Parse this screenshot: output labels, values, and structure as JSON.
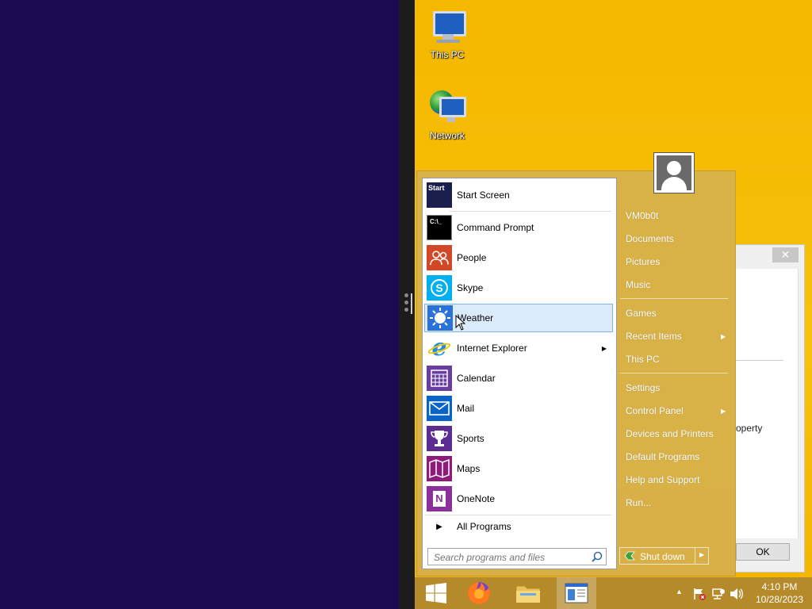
{
  "desktop": {
    "icons": [
      {
        "label": "This PC",
        "icon": "this-pc-icon"
      },
      {
        "label": "Network",
        "icon": "network-icon"
      }
    ]
  },
  "background_dialog": {
    "close_glyph": "✕",
    "fragment_text": "operty",
    "ok_label": "OK"
  },
  "start_menu": {
    "pinned": [
      {
        "label": "Start Screen",
        "icon": "start-screen-icon",
        "icon_text": "Start"
      },
      {
        "label": "Command Prompt",
        "icon": "command-prompt-icon",
        "icon_text": "C:\\_"
      },
      {
        "label": "People",
        "icon": "people-icon"
      },
      {
        "label": "Skype",
        "icon": "skype-icon",
        "icon_text": "S"
      },
      {
        "label": "Weather",
        "icon": "weather-icon"
      },
      {
        "label": "Internet Explorer",
        "icon": "internet-explorer-icon",
        "icon_text": "e"
      },
      {
        "label": "Calendar",
        "icon": "calendar-icon"
      },
      {
        "label": "Mail",
        "icon": "mail-icon"
      },
      {
        "label": "Sports",
        "icon": "sports-icon"
      },
      {
        "label": "Maps",
        "icon": "maps-icon"
      },
      {
        "label": "OneNote",
        "icon": "onenote-icon",
        "icon_text": "N"
      }
    ],
    "all_programs": "All Programs",
    "search_placeholder": "Search programs and files",
    "user_name": "VM0b0t",
    "right_items": [
      "Documents",
      "Pictures",
      "Music",
      "Games",
      "Recent Items",
      "This PC",
      "Settings",
      "Control Panel",
      "Devices and Printers",
      "Default Programs",
      "Help and Support",
      "Run..."
    ],
    "shutdown_label": "Shut down"
  },
  "taskbar": {
    "time": "4:10 PM",
    "date": "10/28/2023"
  },
  "colors": {
    "desktop": "#f5b700",
    "left_pane": "#1b0a52",
    "start_menu": "#d6b04a",
    "highlight": "#dcebfc"
  }
}
